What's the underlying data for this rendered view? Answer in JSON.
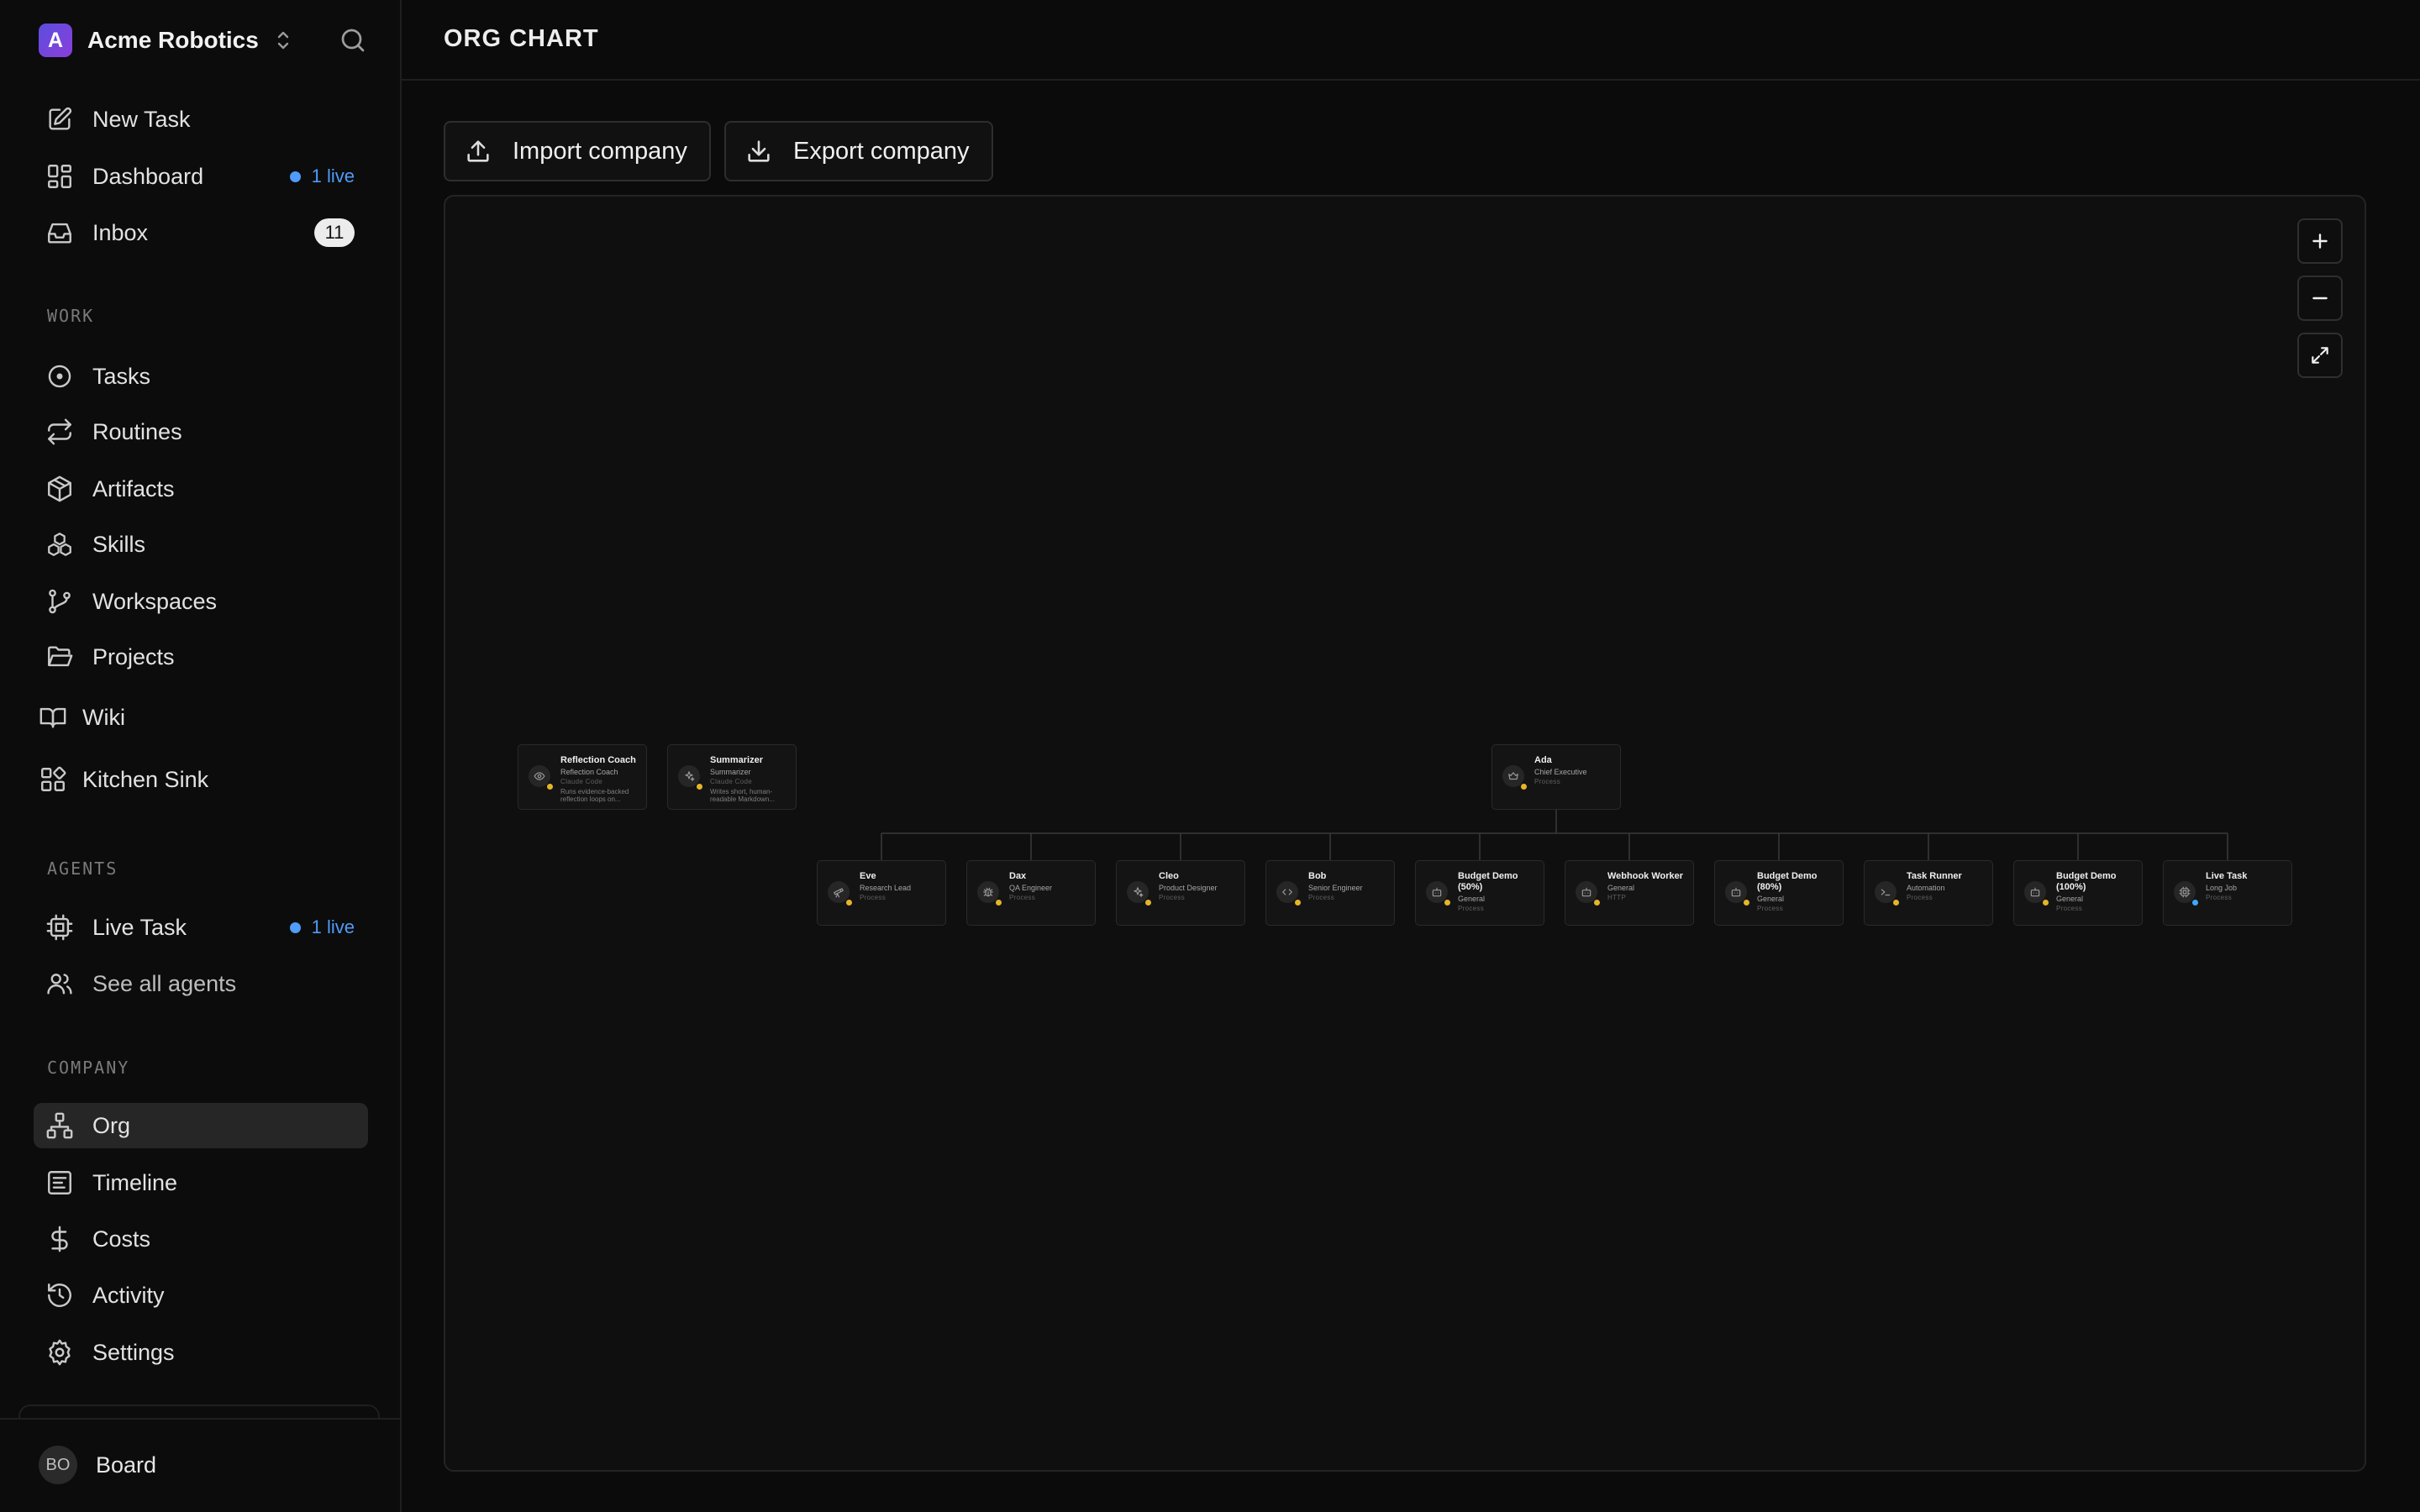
{
  "sidebar": {
    "company": {
      "initial": "A",
      "name": "Acme Robotics"
    },
    "top_items": [
      {
        "label": "New Task"
      },
      {
        "label": "Dashboard",
        "live_text": "1 live"
      },
      {
        "label": "Inbox",
        "count": "11"
      }
    ],
    "work": {
      "label": "WORK",
      "items": [
        {
          "label": "Tasks"
        },
        {
          "label": "Routines"
        },
        {
          "label": "Artifacts"
        },
        {
          "label": "Skills"
        },
        {
          "label": "Workspaces"
        },
        {
          "label": "Projects"
        }
      ]
    },
    "extra_items": [
      {
        "label": "Wiki"
      },
      {
        "label": "Kitchen Sink"
      }
    ],
    "agents": {
      "label": "AGENTS",
      "items": [
        {
          "label": "Live Task",
          "live_text": "1 live"
        },
        {
          "label": "See all agents"
        }
      ]
    },
    "company_section": {
      "label": "COMPANY",
      "items": [
        {
          "label": "Org",
          "active": true
        },
        {
          "label": "Timeline"
        },
        {
          "label": "Costs"
        },
        {
          "label": "Activity"
        },
        {
          "label": "Settings"
        }
      ]
    },
    "user": {
      "initials": "BO",
      "name": "Board"
    }
  },
  "header": {
    "title": "ORG CHART"
  },
  "actions": {
    "import_label": "Import company",
    "export_label": "Export company"
  },
  "org": {
    "ceo": {
      "name": "Ada",
      "role": "Chief Executive",
      "adapter": "Process",
      "icon": "crown-icon",
      "status": "yellow"
    },
    "standalone": [
      {
        "name": "Reflection Coach",
        "role": "Reflection Coach",
        "adapter": "Claude Code",
        "desc": "Runs evidence-backed reflection loops on...",
        "icon": "eye-icon",
        "status": "yellow"
      },
      {
        "name": "Summarizer",
        "role": "Summarizer",
        "adapter": "Claude Code",
        "desc": "Writes short, human-readable Markdown...",
        "icon": "sparkles-icon",
        "status": "yellow"
      }
    ],
    "reports": [
      {
        "name": "Eve",
        "role": "Research Lead",
        "adapter": "Process",
        "icon": "telescope-icon",
        "status": "yellow"
      },
      {
        "name": "Dax",
        "role": "QA Engineer",
        "adapter": "Process",
        "icon": "bug-icon",
        "status": "yellow"
      },
      {
        "name": "Cleo",
        "role": "Product Designer",
        "adapter": "Process",
        "icon": "sparkles-icon",
        "status": "yellow"
      },
      {
        "name": "Bob",
        "role": "Senior Engineer",
        "adapter": "Process",
        "icon": "code-icon",
        "status": "yellow"
      },
      {
        "name": "Budget Demo (50%)",
        "role": "General",
        "adapter": "Process",
        "icon": "bot-icon",
        "status": "yellow"
      },
      {
        "name": "Webhook Worker",
        "role": "General",
        "adapter": "HTTP",
        "icon": "bot-icon",
        "status": "yellow"
      },
      {
        "name": "Budget Demo (80%)",
        "role": "General",
        "adapter": "Process",
        "icon": "bot-icon",
        "status": "yellow"
      },
      {
        "name": "Task Runner",
        "role": "Automation",
        "adapter": "Process",
        "icon": "terminal-icon",
        "status": "yellow"
      },
      {
        "name": "Budget Demo (100%)",
        "role": "General",
        "adapter": "Process",
        "icon": "bot-icon",
        "status": "yellow"
      },
      {
        "name": "Live Task",
        "role": "Long Job",
        "adapter": "Process",
        "icon": "cpu-icon",
        "status": "blue"
      }
    ]
  },
  "colors": {
    "accent_live": "#4f9cf9",
    "status_running": "#e7b429",
    "status_live": "#3fa7ff",
    "active_nav": "#262626"
  }
}
